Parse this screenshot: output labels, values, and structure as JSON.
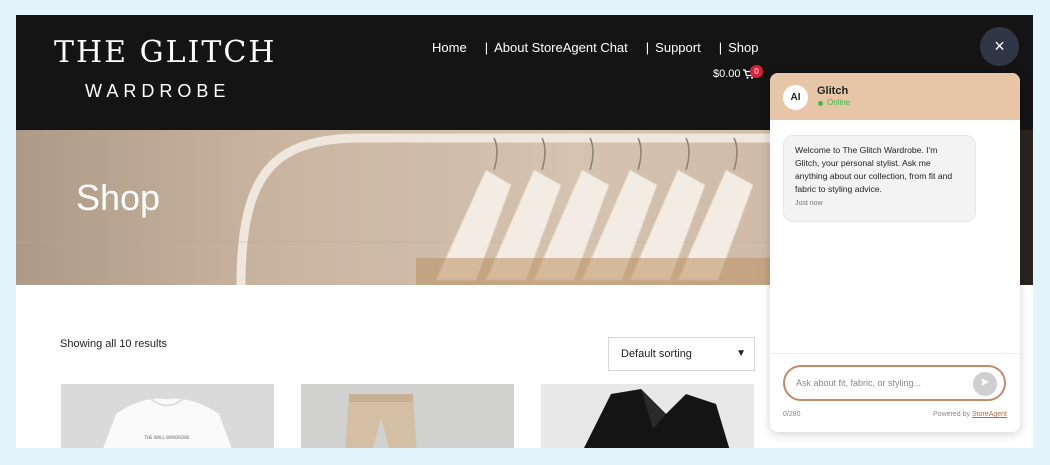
{
  "header": {
    "logo_main": "THE GLITCH",
    "logo_sub": "WARDROBE",
    "nav": [
      {
        "label": "Home"
      },
      {
        "label": "About StoreAgent Chat"
      },
      {
        "label": "Support"
      },
      {
        "label": "Shop"
      }
    ],
    "nav_separator": "|",
    "cart_total": "$0.00",
    "cart_count": "0"
  },
  "hero": {
    "title": "Shop"
  },
  "shop": {
    "results_text": "Showing all 10 results",
    "sort_selected": "Default sorting",
    "product_tag": "THE WALL WARDROBE"
  },
  "chat": {
    "close_label": "×",
    "avatar_initials": "AI",
    "bot_name": "Glitch",
    "status": "Online",
    "welcome_message": "Welcome to The Glitch Wardrobe. I'm Glitch, your personal stylist. Ask me anything about our collection, from fit and fabric to styling advice.",
    "message_time": "Just now",
    "input_placeholder": "Ask about fit, fabric, or styling...",
    "char_counter": "0/280",
    "powered_by_prefix": "Powered by",
    "powered_by_link": "StoreAgent"
  },
  "colors": {
    "header_bg": "#141414",
    "chat_header": "#e6c6a6",
    "input_border": "#c48a6a",
    "online": "#3fb950",
    "badge": "#d9213b"
  }
}
